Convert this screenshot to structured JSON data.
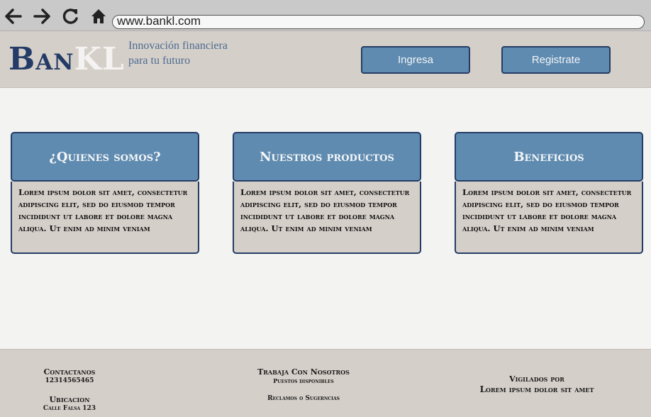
{
  "browser": {
    "url": "www.bankl.com",
    "icons": [
      "back-arrow-icon",
      "forward-arrow-icon",
      "reload-icon",
      "home-icon"
    ]
  },
  "header": {
    "logo_part1": "Ban",
    "logo_part2": "KL",
    "tagline": "Innovación financiera para tu futuro",
    "login_label": "Ingresa",
    "register_label": "Registrate"
  },
  "cards": [
    {
      "title": "¿Quienes somos?",
      "body": "Lorem ipsum dolor sit amet, consectetur adipiscing elit, sed do eiusmod tempor incididunt ut labore et dolore magna aliqua. Ut enim ad minim veniam"
    },
    {
      "title": "Nuestros productos",
      "body": "Lorem ipsum dolor sit amet, consectetur adipiscing elit, sed do eiusmod tempor incididunt ut labore et dolore magna aliqua. Ut enim ad minim veniam"
    },
    {
      "title": "Beneficios",
      "body": "Lorem ipsum dolor sit amet, consectetur adipiscing elit, sed do eiusmod tempor incididunt ut labore et dolore magna aliqua. Ut enim ad minim veniam"
    }
  ],
  "footer": {
    "contact_label": "Contactanos",
    "contact_phone": "12314565465",
    "location_label": "Ubicacion",
    "location_address": "Calle Falsa 123",
    "jobs_label": "Trabaja Con Nosotros",
    "jobs_sub": "Puestos disponibles",
    "claims_label": "Reclamos o Sugerncias",
    "supervised_label": "Vigilados por",
    "supervised_value": "Lorem ipsum dolor sit amet"
  },
  "colors": {
    "primary_blue": "#5f8bb0",
    "dark_navy": "#253d66",
    "beige": "#d5cfc9",
    "page_bg": "#f3f3f2"
  }
}
